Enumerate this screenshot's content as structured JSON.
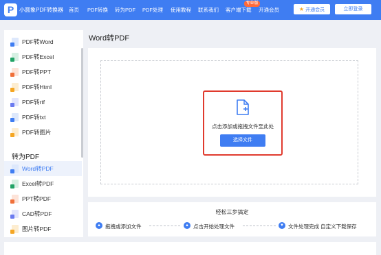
{
  "header": {
    "app_name": "小圆象PDF转换器",
    "logo_letter": "P",
    "nav": [
      "首页",
      "PDF转换",
      "转为PDF",
      "PDF处理",
      "使用教程",
      "联系我们",
      "客户端下载",
      "开通会员"
    ],
    "badge": "专业版",
    "vip_button": "开通会员",
    "login_button": "立即登录"
  },
  "sidebar": {
    "group1": [
      {
        "label": "PDF转Word",
        "icon": "word-icon",
        "color": "#3f7df2"
      },
      {
        "label": "PDF转Excel",
        "icon": "excel-icon",
        "color": "#21a366"
      },
      {
        "label": "PDF转PPT",
        "icon": "ppt-icon",
        "color": "#f0703a"
      },
      {
        "label": "PDF转Html",
        "icon": "html-icon",
        "color": "#f5a623"
      },
      {
        "label": "PDF转rtf",
        "icon": "rtf-icon",
        "color": "#6b7bf0"
      },
      {
        "label": "PDF转txt",
        "icon": "txt-icon",
        "color": "#3f7df2"
      },
      {
        "label": "PDF转图片",
        "icon": "image-icon",
        "color": "#f5a623"
      }
    ],
    "section_title": "转为PDF",
    "group2": [
      {
        "label": "Word转PDF",
        "icon": "word-icon",
        "color": "#3f7df2",
        "active": true
      },
      {
        "label": "Excel转PDF",
        "icon": "excel-icon",
        "color": "#21a366"
      },
      {
        "label": "PPT转PDF",
        "icon": "ppt-icon",
        "color": "#f0703a"
      },
      {
        "label": "CAD转PDF",
        "icon": "cad-icon",
        "color": "#6b7bf0"
      },
      {
        "label": "图片转PDF",
        "icon": "image-icon",
        "color": "#f5a623"
      }
    ]
  },
  "main": {
    "title": "Word转PDF",
    "drop_text": "点击添加或拖拽文件至此处",
    "choose_button": "选择文件"
  },
  "steps": {
    "title": "轻松三步搞定",
    "items": [
      "拖拽或添加文件",
      "点击开始处理文件",
      "文件处理完成 自定义下载保存"
    ]
  },
  "colors": {
    "brand": "#3f7df2",
    "highlight": "#e03a2d"
  }
}
